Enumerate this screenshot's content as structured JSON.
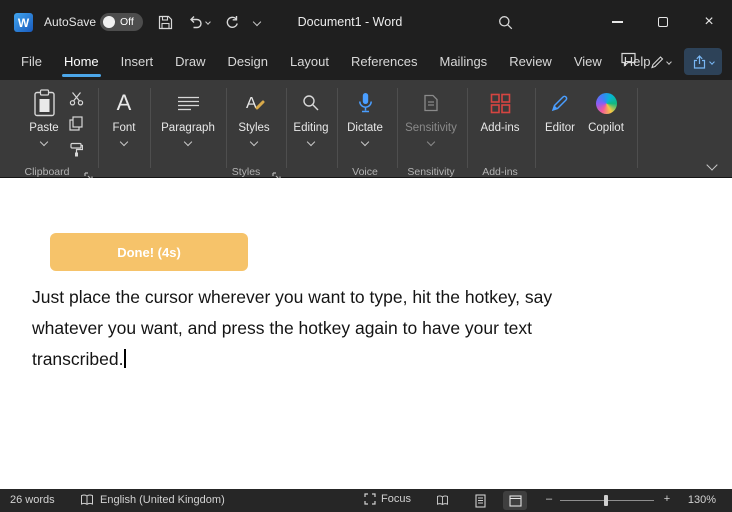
{
  "titlebar": {
    "logo_letter": "W",
    "autosave_label": "AutoSave",
    "autosave_state": "Off",
    "title": "Document1 - Word",
    "close_glyph": "×"
  },
  "menu": {
    "tabs": [
      "File",
      "Home",
      "Insert",
      "Draw",
      "Design",
      "Layout",
      "References",
      "Mailings",
      "Review",
      "View",
      "Help"
    ],
    "active_tab": "Home"
  },
  "ribbon": {
    "paste_label": "Paste",
    "font_label": "Font",
    "font_icon_letter": "A",
    "paragraph_label": "Paragraph",
    "styles_label": "Styles",
    "styles_icon_letter": "A",
    "editing_label": "Editing",
    "dictate_label": "Dictate",
    "sensitivity_label": "Sensitivity",
    "addins_label": "Add-ins",
    "editor_label": "Editor",
    "copilot_label": "Copilot",
    "group_clipboard": "Clipboard",
    "group_styles": "Styles",
    "group_voice": "Voice",
    "group_sensitivity": "Sensitivity",
    "group_addins": "Add-ins"
  },
  "document": {
    "toast_label": "Done! (4s)",
    "lines": [
      "Just place the cursor wherever you want to type, hit the hotkey, say",
      "whatever you want, and press the hotkey again to have your text",
      "transcribed."
    ]
  },
  "statusbar": {
    "word_count": "26 words",
    "language": "English (United Kingdom)",
    "focus_label": "Focus",
    "zoom_out_glyph": "–",
    "zoom_in_glyph": "+",
    "zoom_level": "130%"
  },
  "colors": {
    "accent": "#4ca6e8",
    "titlebar_bg": "#1f1f1f",
    "ribbon_bg": "#3a3a3a",
    "toast": "#f6c36a",
    "dictate_blue": "#4a9eff",
    "addins_red": "#d64541"
  }
}
